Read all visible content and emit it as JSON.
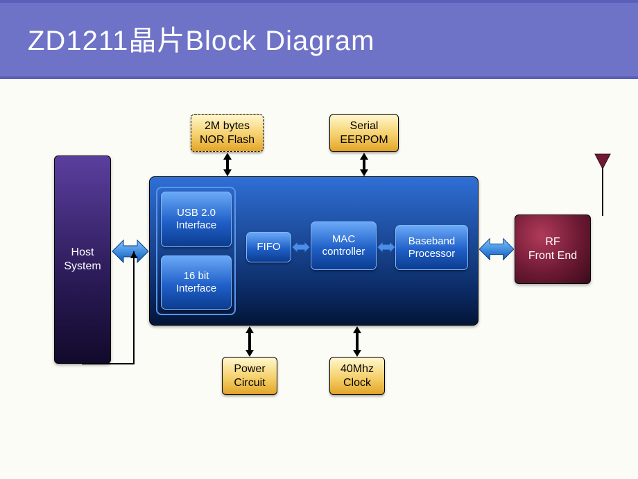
{
  "title": "ZD1211晶片Block Diagram",
  "blocks": {
    "host": "Host\nSystem",
    "rf": "RF\nFront End",
    "usb": "USB 2.0\nInterface",
    "bit16": "16 bit\nInterface",
    "fifo": "FIFO",
    "mac": "MAC\ncontroller",
    "baseband": "Baseband\nProcessor",
    "nor": "2M bytes\nNOR Flash",
    "eeprom": "Serial\nEERPOM",
    "power": "Power\nCircuit",
    "clock": "40Mhz\nClock"
  }
}
